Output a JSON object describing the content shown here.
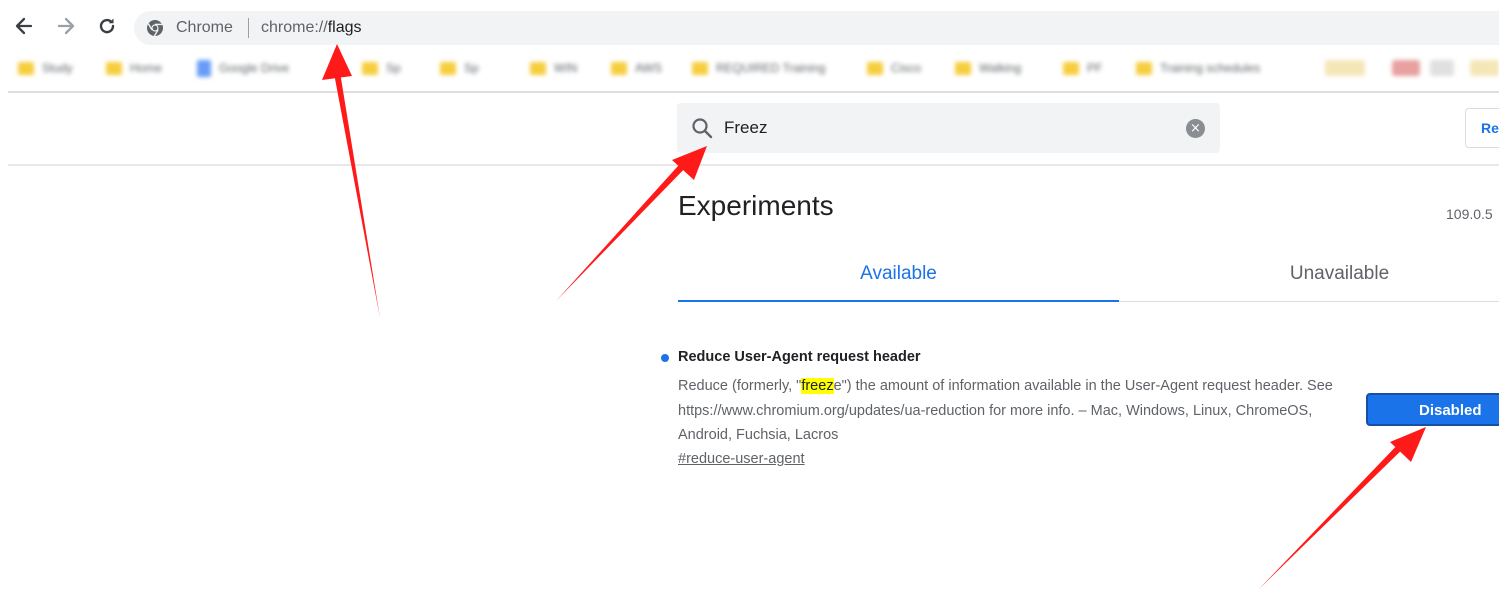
{
  "toolbar": {
    "back_icon": "arrow-left-icon",
    "forward_icon": "arrow-right-icon",
    "reload_icon": "reload-icon",
    "site_label": "Chrome",
    "url_scheme": "chrome://",
    "url_host": "flags"
  },
  "bookmarks": {
    "items": [
      {
        "icon": "folder-icon",
        "label": "Study"
      },
      {
        "icon": "folder-icon",
        "label": "Home"
      },
      {
        "icon": "doc-icon",
        "label": "Google Drive"
      },
      {
        "icon": "folder-icon",
        "label": "Sp"
      },
      {
        "icon": "folder-icon",
        "label": "Sp"
      },
      {
        "icon": "folder-icon",
        "label": "WIN"
      },
      {
        "icon": "folder-icon",
        "label": "AWS"
      },
      {
        "icon": "folder-icon",
        "label": "REQUIRED Training"
      },
      {
        "icon": "folder-icon",
        "label": "Cisco"
      },
      {
        "icon": "folder-icon",
        "label": "Walking"
      },
      {
        "icon": "folder-icon",
        "label": "PF"
      },
      {
        "icon": "folder-icon",
        "label": "Training schedules"
      }
    ]
  },
  "search": {
    "value": "Freez",
    "clear_icon": "×"
  },
  "reset_label": "Re",
  "page": {
    "title": "Experiments",
    "version": "109.0.5"
  },
  "tabs": [
    {
      "label": "Available",
      "selected": true
    },
    {
      "label": "Unavailable",
      "selected": false
    }
  ],
  "experiment": {
    "title": "Reduce User-Agent request header",
    "desc_before": "Reduce (formerly, \"",
    "desc_highlight": "freez",
    "desc_after": "e\") the amount of information available in the User-Agent request header. See https://www.chromium.org/updates/ua-reduction for more info. – Mac, Windows, Linux, ChromeOS, Android, Fuchsia, Lacros",
    "link": "#reduce-user-agent",
    "select_value": "Disabled"
  },
  "colors": {
    "accent": "#1a73e8",
    "highlight": "#ffff00",
    "annotation_arrow": "#ff1a1a"
  }
}
